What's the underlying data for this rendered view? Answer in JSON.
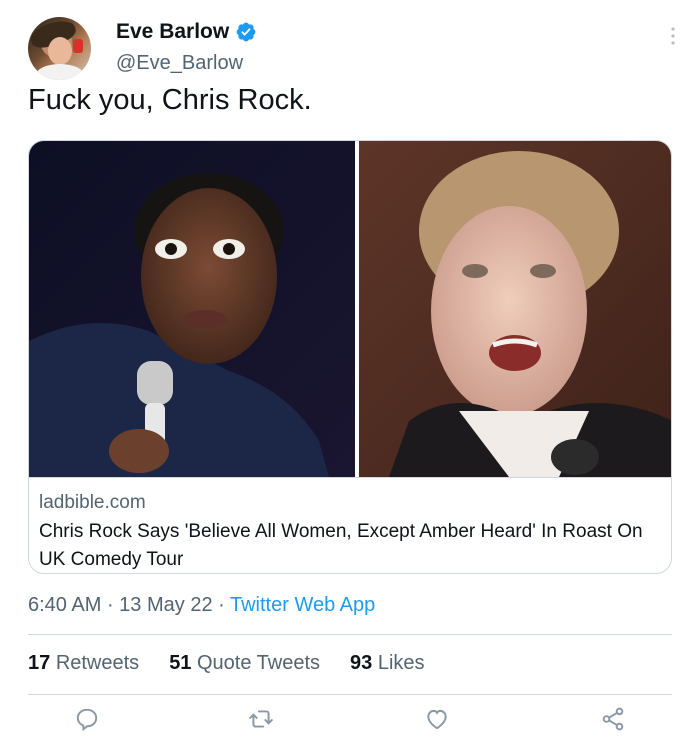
{
  "author": {
    "display_name": "Eve Barlow",
    "handle": "@Eve_Barlow",
    "verified": true
  },
  "tweet": {
    "text": "Fuck you, Chris Rock."
  },
  "link_card": {
    "domain": "ladbible.com",
    "title": "Chris Rock Says 'Believe All Women, Except Amber Heard' In Roast On UK Comedy Tour"
  },
  "meta": {
    "time": "6:40 AM",
    "sep1": " · ",
    "date": "13 May 22",
    "sep2": " · ",
    "source": "Twitter Web App"
  },
  "stats": {
    "retweets_count": "17",
    "retweets_label": "Retweets",
    "quotes_count": "51",
    "quotes_label": "Quote Tweets",
    "likes_count": "93",
    "likes_label": "Likes"
  },
  "icons": {
    "more": "more-vertical-icon",
    "reply": "reply-icon",
    "retweet": "retweet-icon",
    "like": "heart-icon",
    "share": "share-icon",
    "verified": "verified-badge-icon"
  },
  "colors": {
    "accent": "#1d9bf0",
    "secondary_text": "#536471",
    "divider": "#cfd9de"
  }
}
